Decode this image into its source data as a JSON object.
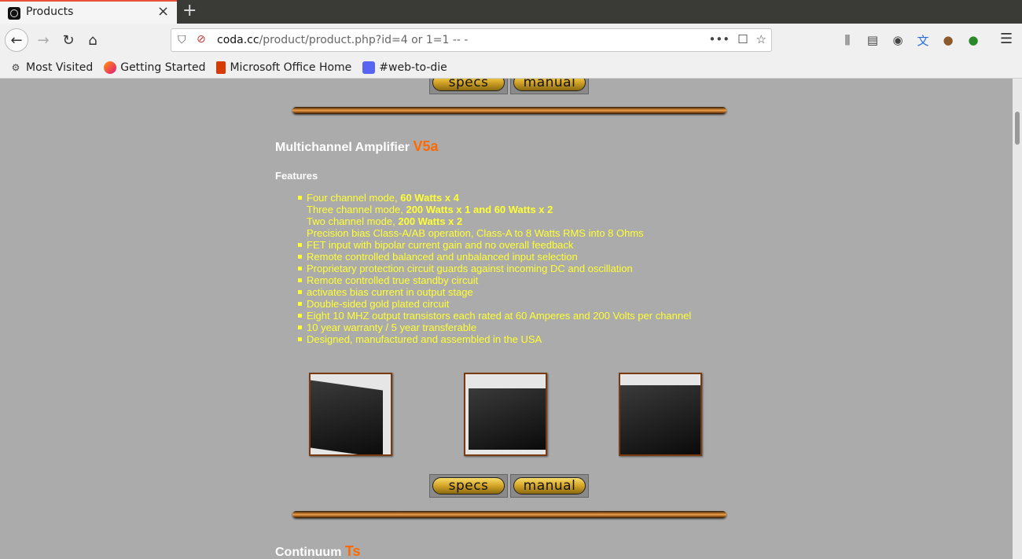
{
  "browser": {
    "tab_title": "Products",
    "tab_close": "×",
    "new_tab": "+",
    "url_host": "coda.cc",
    "url_path": "/product/product.php?id=4 or 1=1 -- -",
    "url_actions": [
      "•••",
      "☐",
      "☆"
    ],
    "bookmarks": [
      {
        "label": "Most Visited",
        "icon": "gear-icon"
      },
      {
        "label": "Getting Started",
        "icon": "firefox-icon"
      },
      {
        "label": "Microsoft Office Home",
        "icon": "office-icon"
      },
      {
        "label": "#web-to-die",
        "icon": "discord-icon"
      }
    ]
  },
  "page": {
    "buttons": {
      "specs": "specs",
      "manual": "manual"
    },
    "product1": {
      "name": "Multichannel Amplifier",
      "model": "V5a",
      "features_heading": "Features",
      "features": [
        {
          "text": "Four channel mode, ",
          "bold": "60 Watts x 4",
          "bullet": true
        },
        {
          "text": "Three channel mode, ",
          "bold": "200 Watts x 1 and 60 Watts x 2",
          "bullet": false
        },
        {
          "text": "Two channel mode, ",
          "bold": "200 Watts x 2",
          "bullet": false
        },
        {
          "text": "Precision bias Class-A/AB operation, Class-A to 8 Watts RMS into 8 Ohms",
          "bold": "",
          "bullet": false
        },
        {
          "text": "FET input with bipolar current gain and no overall feedback",
          "bold": "",
          "bullet": true
        },
        {
          "text": "Remote controlled balanced and unbalanced input selection",
          "bold": "",
          "bullet": true
        },
        {
          "text": "Proprietary protection circuit guards against incoming DC and oscillation",
          "bold": "",
          "bullet": true
        },
        {
          "text": "Remote controlled true standby circuit",
          "bold": "",
          "bullet": true
        },
        {
          "text": "activates bias current in output stage",
          "bold": "",
          "bullet": true
        },
        {
          "text": "Double-sided gold plated circuit",
          "bold": "",
          "bullet": true
        },
        {
          "text": "Eight 10 MHZ output transistors each rated at 60 Amperes and 200 Volts per channel",
          "bold": "",
          "bullet": true
        },
        {
          "text": "10 year warranty / 5 year transferable",
          "bold": "",
          "bullet": true
        },
        {
          "text": "Designed, manufactured and assembled in the USA",
          "bold": "",
          "bullet": true
        }
      ]
    },
    "product2": {
      "name": "Continuum",
      "model": "Ts"
    }
  }
}
